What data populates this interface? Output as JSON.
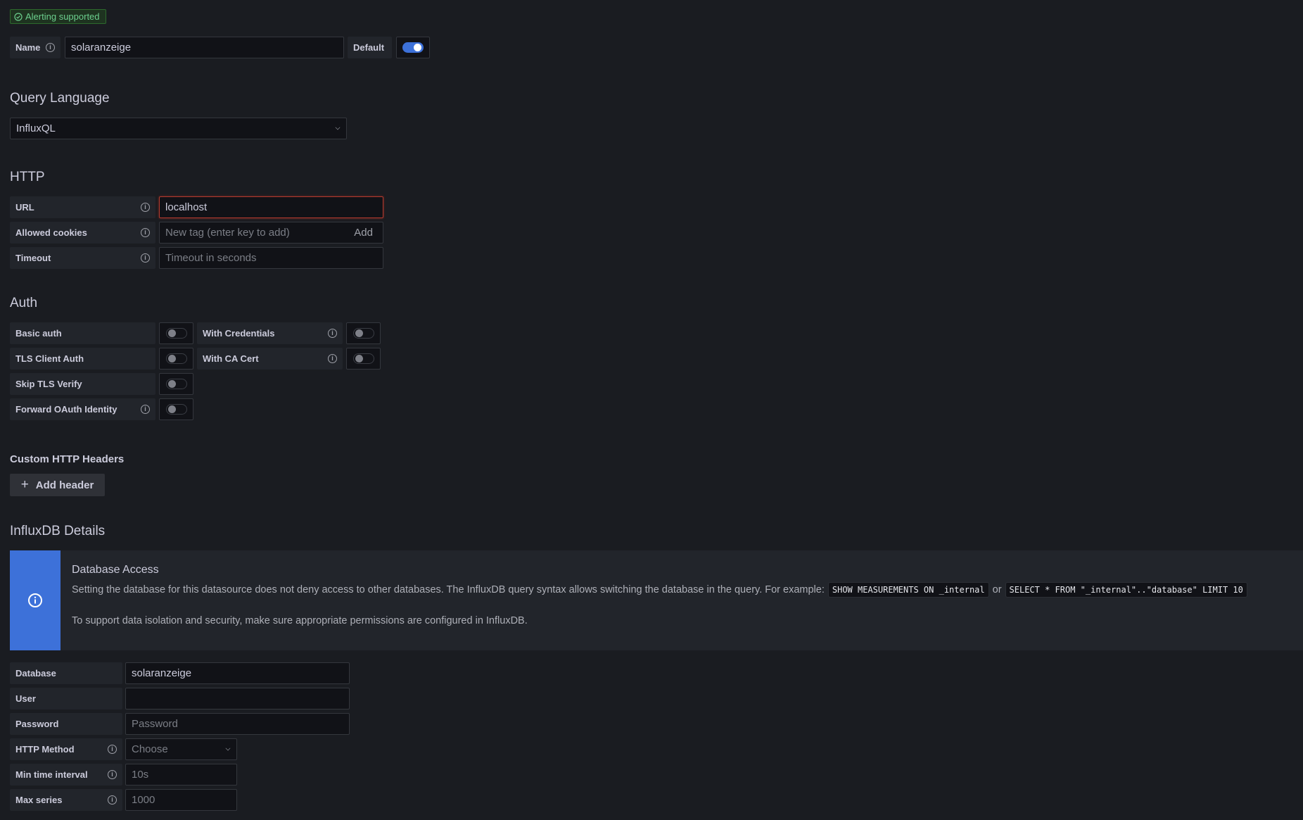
{
  "badge": {
    "label": "Alerting supported",
    "color": "#6ccf8e"
  },
  "name_row": {
    "label": "Name",
    "value": "solaranzeige",
    "default_label": "Default",
    "default_on": true
  },
  "query_language": {
    "heading": "Query Language",
    "selected": "InfluxQL"
  },
  "http": {
    "heading": "HTTP",
    "url": {
      "label": "URL",
      "value": "localhost"
    },
    "allowed_cookies": {
      "label": "Allowed cookies",
      "placeholder": "New tag (enter key to add)",
      "add_label": "Add"
    },
    "timeout": {
      "label": "Timeout",
      "placeholder": "Timeout in seconds"
    }
  },
  "auth": {
    "heading": "Auth",
    "basic_auth": {
      "label": "Basic auth",
      "on": false
    },
    "with_credentials": {
      "label": "With Credentials",
      "on": false
    },
    "tls_client_auth": {
      "label": "TLS Client Auth",
      "on": false
    },
    "with_ca_cert": {
      "label": "With CA Cert",
      "on": false
    },
    "skip_tls_verify": {
      "label": "Skip TLS Verify",
      "on": false
    },
    "forward_oauth": {
      "label": "Forward OAuth Identity",
      "on": false
    }
  },
  "custom_headers": {
    "heading": "Custom HTTP Headers",
    "add_label": "Add header"
  },
  "influx": {
    "heading": "InfluxDB Details",
    "alert": {
      "title": "Database Access",
      "text1": "Setting the database for this datasource does not deny access to other databases. The InfluxDB query syntax allows switching the database in the query. For example:",
      "code1": "SHOW MEASUREMENTS ON _internal",
      "or": "or",
      "code2": "SELECT * FROM \"_internal\"..\"database\" LIMIT 10",
      "text2": "To support data isolation and security, make sure appropriate permissions are configured in InfluxDB."
    },
    "database": {
      "label": "Database",
      "value": "solaranzeige"
    },
    "user": {
      "label": "User",
      "value": ""
    },
    "password": {
      "label": "Password",
      "placeholder": "Password"
    },
    "http_method": {
      "label": "HTTP Method",
      "placeholder": "Choose"
    },
    "min_time_interval": {
      "label": "Min time interval",
      "placeholder": "10s"
    },
    "max_series": {
      "label": "Max series",
      "placeholder": "1000"
    }
  }
}
